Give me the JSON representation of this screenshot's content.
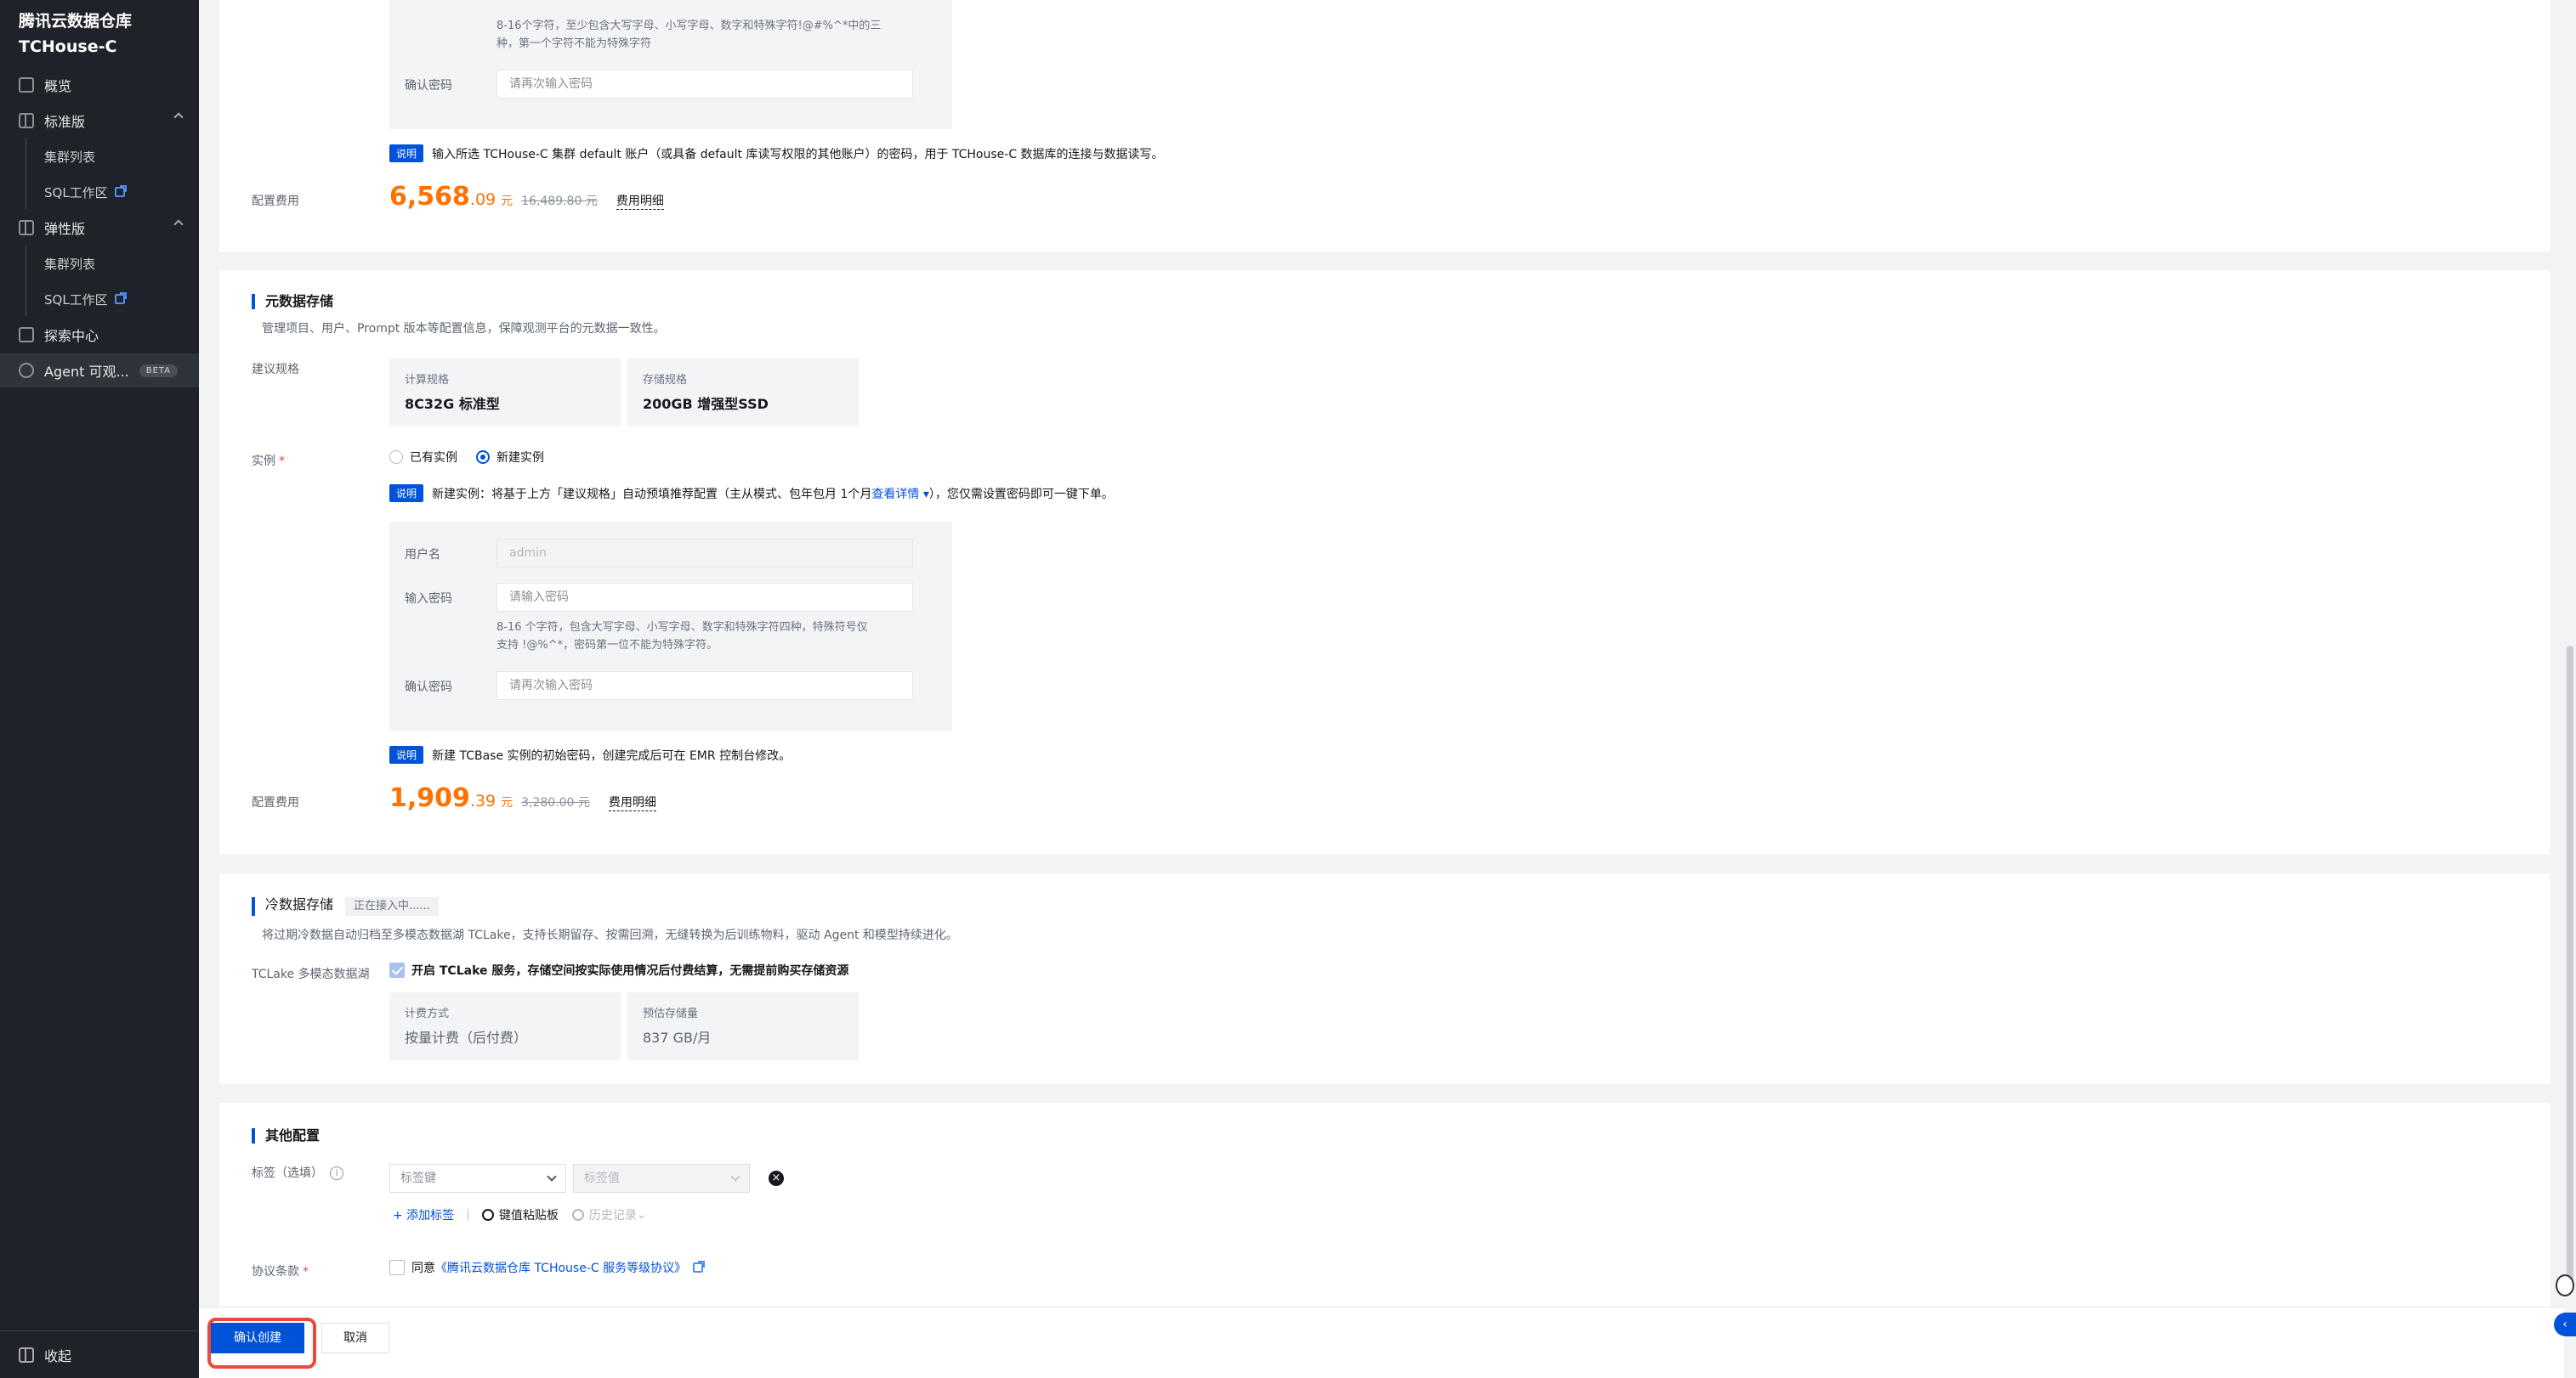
{
  "sidebar": {
    "brand_line1": "腾讯云数据仓库",
    "brand_line2": "TCHouse-C",
    "overview": "概览",
    "standard": "标准版",
    "standard_cluster_list": "集群列表",
    "standard_sql": "SQL工作区",
    "elastic": "弹性版",
    "elastic_cluster_list": "集群列表",
    "elastic_sql": "SQL工作区",
    "explore": "探索中心",
    "agent": "Agent 可观...",
    "agent_badge": "BETA",
    "collapse": "收起"
  },
  "top_section": {
    "password_hint_line1": "8-16个字符，至少包含大写字母、小写字母、数字和特殊字符!@#%^*中的三",
    "password_hint_line2": "种，第一个字符不能为特殊字符",
    "confirm_password_label": "确认密码",
    "confirm_password_placeholder": "请再次输入密码",
    "note_tag": "说明",
    "note_text": "输入所选 TCHouse-C 集群 default 账户（或具备 default 库读写权限的其他账户）的密码，用于 TCHouse-C 数据库的连接与数据读写。",
    "fee_label": "配置费用",
    "price_int": "6,568",
    "price_dec": ".09",
    "price_unit": "元",
    "price_old": "16,489.80 元",
    "fee_detail": "费用明细"
  },
  "metadata_storage": {
    "title": "元数据存储",
    "desc": "管理项目、用户、Prompt 版本等配置信息，保障观测平台的元数据一致性。",
    "spec_label": "建议规格",
    "compute_key": "计算规格",
    "compute_value": "8C32G 标准型",
    "storage_key": "存储规格",
    "storage_value": "200GB 增强型SSD",
    "instance_label": "实例",
    "radio_existing": "已有实例",
    "radio_new": "新建实例",
    "note_tag": "说明",
    "note_text_pre": "新建实例：将基于上方「建议规格」自动预填推荐配置（主从模式、包年包月 1个月 ",
    "note_link": "查看详情 ▾",
    "note_text_post": "），您仅需设置密码即可一键下单。",
    "username_label": "用户名",
    "username_value": "admin",
    "password_label": "输入密码",
    "password_placeholder": "请输入密码",
    "password_hint_line1": "8-16 个字符，包含大写字母、小写字母、数字和特殊字符四种，特殊符号仅",
    "password_hint_line2": "支持 !@%^*，密码第一位不能为特殊字符。",
    "confirm_label": "确认密码",
    "confirm_placeholder": "请再次输入密码",
    "note2_tag": "说明",
    "note2_text": "新建 TCBase 实例的初始密码，创建完成后可在 EMR 控制台修改。",
    "fee_label": "配置费用",
    "price_int": "1,909",
    "price_dec": ".39",
    "price_unit": "元",
    "price_old": "3,280.00 元",
    "fee_detail": "费用明细"
  },
  "cold_storage": {
    "title": "冷数据存储",
    "status_tag": "正在接入中......",
    "desc": "将过期冷数据自动归档至多模态数据湖 TCLake，支持长期留存、按需回溯，无缝转换为后训练物料，驱动 Agent 和模型持续进化。",
    "lake_label": "TCLake 多模态数据湖",
    "checkbox_text": "开启 TCLake 服务，存储空间按实际使用情况后付费结算，无需提前购买存储资源",
    "billing_key": "计费方式",
    "billing_value": "按量计费（后付费）",
    "est_key": "预估存储量",
    "est_value": "837 GB/月"
  },
  "other_config": {
    "title": "其他配置",
    "tag_label": "标签（选填）",
    "tag_key_placeholder": "标签键",
    "tag_value_placeholder": "标签值",
    "add_tag": "+ 添加标签",
    "sep": "|",
    "paste": "键值粘贴板",
    "history": "历史记录",
    "agreement_label": "协议条款",
    "agree_prefix": "同意",
    "agreement_link": "《腾讯云数据仓库 TCHouse-C 服务等级协议》"
  },
  "footer": {
    "confirm": "确认创建",
    "cancel": "取消"
  },
  "colors": {
    "primary": "#0052d9",
    "price": "#ff7200",
    "highlight_border": "#e84a3c",
    "sidebar_bg": "#1f2329"
  }
}
